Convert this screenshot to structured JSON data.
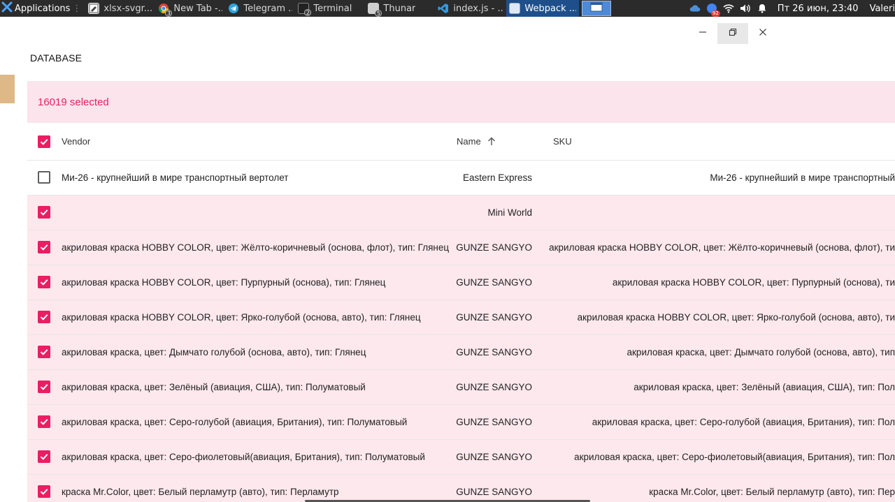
{
  "panel": {
    "apps_label": "Applications",
    "tasks": [
      {
        "label": "xlsx-svgr...",
        "icon": "document-editor-icon",
        "badge": ""
      },
      {
        "label": "New Tab -...",
        "icon": "chrome-icon",
        "badge": "3"
      },
      {
        "label": "Telegram ...",
        "icon": "telegram-icon",
        "badge": ""
      },
      {
        "label": "Terminal",
        "icon": "terminal-icon",
        "badge": "2"
      },
      {
        "label": "Thunar",
        "icon": "file-manager-icon",
        "badge": "5"
      },
      {
        "label": "index.js - ...",
        "icon": "vscode-icon",
        "badge": ""
      },
      {
        "label": "Webpack ...",
        "icon": "window-icon",
        "badge": ""
      }
    ],
    "tray_badge": "92",
    "clock": "Пт 26 июн, 23:40",
    "user": "Valeri"
  },
  "page": {
    "title": "DATABASE"
  },
  "table": {
    "selected_text": "16019 selected",
    "columns": {
      "vendor": "Vendor",
      "name": "Name",
      "sku": "SKU"
    },
    "rows": [
      {
        "checked": false,
        "vendor": "Ми-26 - крупнейший в мире транспортный вертолет",
        "name": "Eastern Express",
        "sku": "Ми-26 - крупнейший в мире транспортный"
      },
      {
        "checked": true,
        "vendor": "",
        "name": "Mini World",
        "sku": ""
      },
      {
        "checked": true,
        "vendor": "акриловая краска HOBBY COLOR, цвет: Жёлто-коричневый (основа, флот), тип: Глянец",
        "name": "GUNZE SANGYO",
        "sku": "акриловая краска HOBBY COLOR, цвет: Жёлто-коричневый (основа, флот), ти"
      },
      {
        "checked": true,
        "vendor": "акриловая краска HOBBY COLOR, цвет: Пурпурный (основа), тип: Глянец",
        "name": "GUNZE SANGYO",
        "sku": "акриловая краска HOBBY COLOR, цвет: Пурпурный (основа), ти"
      },
      {
        "checked": true,
        "vendor": "акриловая краска HOBBY COLOR, цвет: Ярко-голубой (основа, авто), тип: Глянец",
        "name": "GUNZE SANGYO",
        "sku": "акриловая краска HOBBY COLOR, цвет: Ярко-голубой (основа, авто), ти"
      },
      {
        "checked": true,
        "vendor": "акриловая краска, цвет: Дымчато голубой (основа, авто), тип: Глянец",
        "name": "GUNZE SANGYO",
        "sku": "акриловая краска, цвет: Дымчато голубой (основа, авто), тип"
      },
      {
        "checked": true,
        "vendor": "акриловая краска, цвет: Зелёный (авиация, США), тип: Полуматовый",
        "name": "GUNZE SANGYO",
        "sku": "акриловая краска, цвет: Зелёный (авиация, США), тип: Пол"
      },
      {
        "checked": true,
        "vendor": "акриловая краска, цвет: Серо-голубой (авиация, Британия), тип: Полуматовый",
        "name": "GUNZE SANGYO",
        "sku": "акриловая краска, цвет: Серо-голубой (авиация, Британия), тип: Пол"
      },
      {
        "checked": true,
        "vendor": "акриловая краска, цвет: Серо-фиолетовый(авиация, Британия), тип: Полуматовый",
        "name": "GUNZE SANGYO",
        "sku": "акриловая краска, цвет: Серо-фиолетовый(авиация, Британия), тип: Пол"
      },
      {
        "checked": true,
        "vendor": "краска Mr.Color, цвет: Белый перламутр (авто), тип: Перламутр",
        "name": "GUNZE SANGYO",
        "sku": "краска Mr.Color, цвет: Белый перламутр (авто), тип: Пер"
      }
    ]
  },
  "colors": {
    "accent": "#e91e63",
    "selected_row_bg": "#fde8ee",
    "toolbar_bg": "#fce4ec",
    "panel_bg": "#2b2b2b"
  }
}
